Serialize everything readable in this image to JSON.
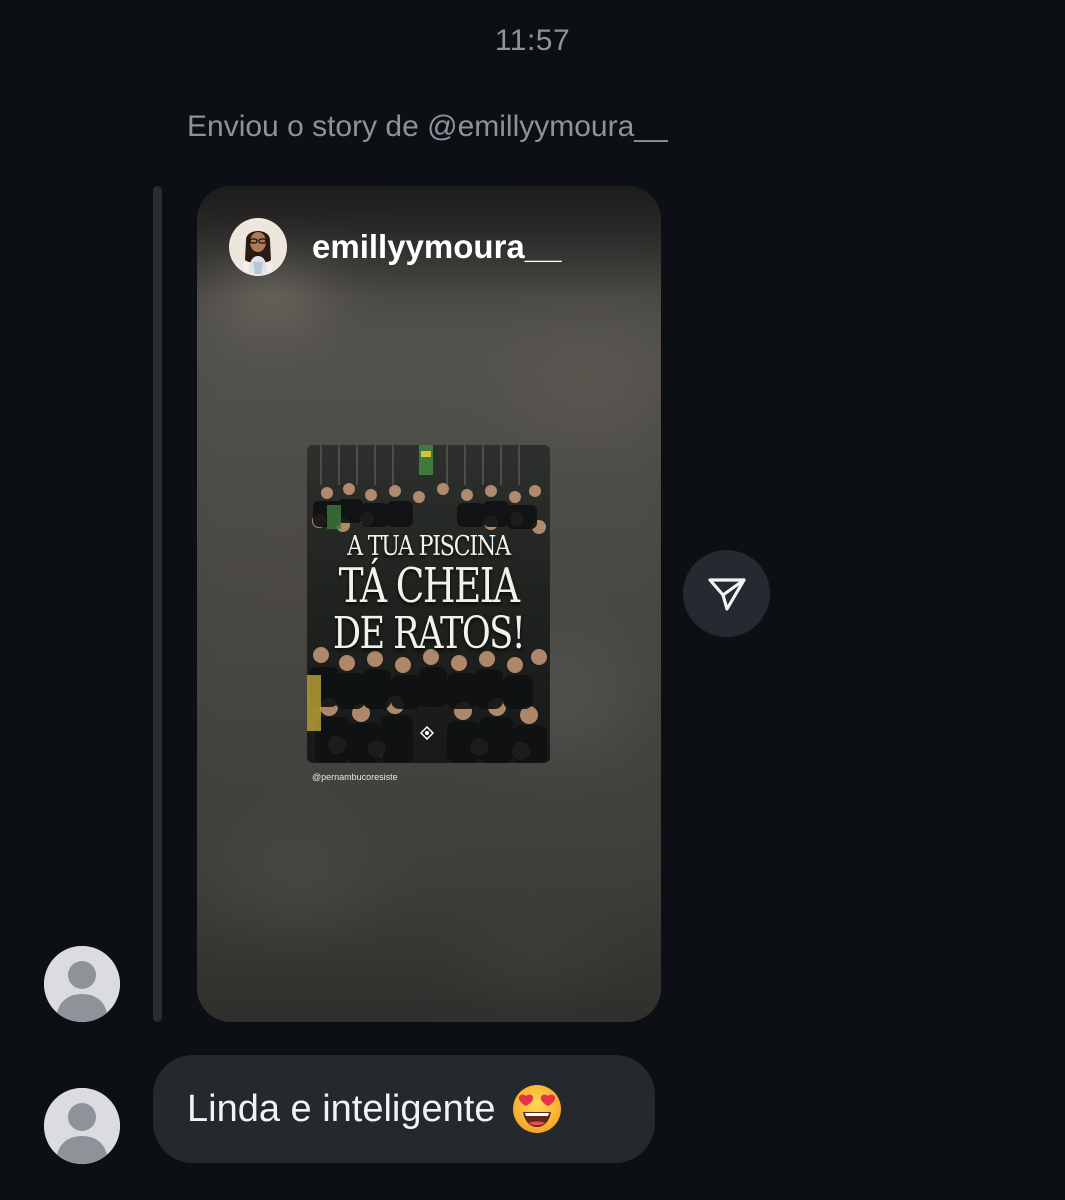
{
  "thread": {
    "timestamp": "11:57",
    "story_caption": "Enviou o story de @emillyymoura__"
  },
  "story": {
    "username": "emillyymoura__",
    "poster": {
      "line1": "A TUA PISCINA",
      "line2": "TÁ CHEIA",
      "line3": "DE RATOS!",
      "handle": "@pernambucoresiste"
    }
  },
  "actions": {
    "share_icon": "send-icon"
  },
  "messages": [
    {
      "text": "Linda e inteligente",
      "emoji": "heart-eyes-emoji"
    }
  ],
  "colors": {
    "background": "#0c0f14",
    "bubble": "#25282d",
    "muted_text": "#8d929b",
    "avatar_placeholder": "#dbdcdf"
  }
}
